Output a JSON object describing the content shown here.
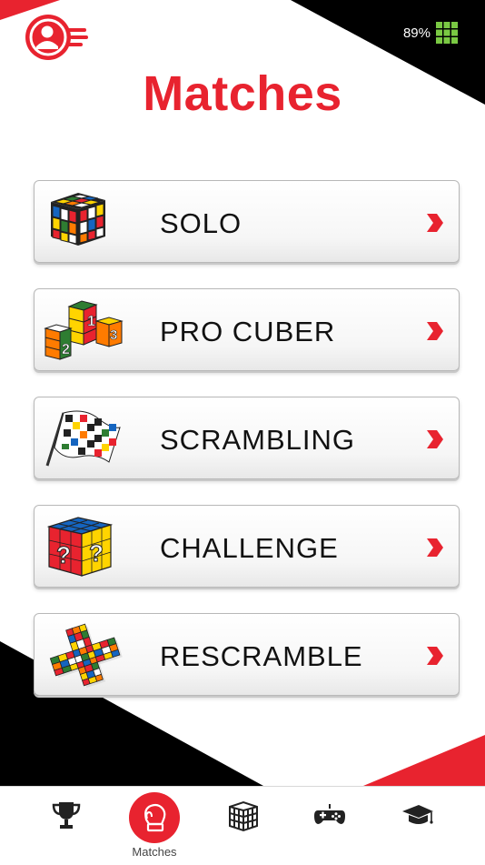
{
  "status": {
    "battery_label": "89%"
  },
  "header": {
    "title": "Matches"
  },
  "menu": [
    {
      "label": "SOLO",
      "icon": "rubiks-cube-icon"
    },
    {
      "label": "PRO CUBER",
      "icon": "podium-cubes-icon"
    },
    {
      "label": "SCRAMBLING",
      "icon": "checkered-flag-icon"
    },
    {
      "label": "CHALLENGE",
      "icon": "question-cube-icon"
    },
    {
      "label": "RESCRAMBLE",
      "icon": "unfolded-cube-icon"
    }
  ],
  "tabs": [
    {
      "label": "",
      "icon": "trophy-icon"
    },
    {
      "label": "Matches",
      "icon": "boxing-glove-icon",
      "active": true
    },
    {
      "label": "",
      "icon": "cube-icon"
    },
    {
      "label": "",
      "icon": "gamepad-icon"
    },
    {
      "label": "",
      "icon": "graduation-cap-icon"
    }
  ],
  "colors": {
    "accent": "#e8232f",
    "dark": "#000000",
    "battery": "#7ac943"
  }
}
